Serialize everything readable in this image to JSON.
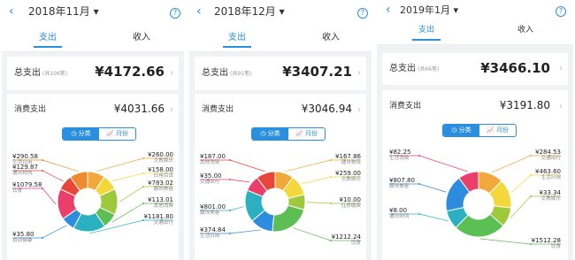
{
  "panels": [
    {
      "header": {
        "back": "‹",
        "title": "2018年11月 ▾",
        "help": "?"
      },
      "tabs": [
        "支出",
        "收入"
      ],
      "summary": {
        "total_label": "总支出",
        "total_count": "(共106笔)",
        "total_value": "¥4172.66",
        "consumption_label": "消费支出",
        "consumption_value": "¥4031.66",
        "arrow": "›"
      },
      "toggle": [
        "◷ 分类",
        "📈 月份"
      ],
      "chart_data": {
        "type": "pie",
        "slices": [
          {
            "value": "¥260.00",
            "label": "文教娱乐",
            "color": "#f0a93a"
          },
          {
            "value": "¥158.00",
            "label": "日用百货",
            "color": "#f3d83c"
          },
          {
            "value": "¥783.02",
            "label": "服饰美容",
            "color": "#9fc93c"
          },
          {
            "value": "¥113.01",
            "label": "其他消费",
            "color": "#5cbf54"
          },
          {
            "value": "¥1181.80",
            "label": "交通出行",
            "color": "#2bb0c2"
          },
          {
            "value": "¥35.80",
            "label": "运动健康",
            "color": "#2d8cde"
          },
          {
            "value": "¥1079.58",
            "label": "饮食",
            "color": "#ea3f6b"
          },
          {
            "value": "¥129.87",
            "label": "通讯物流",
            "color": "#e9463a"
          },
          {
            "value": "¥290.58",
            "label": "生活日用",
            "color": "#f08a2e"
          }
        ]
      }
    },
    {
      "header": {
        "back": "‹",
        "title": "2018年12月 ▾",
        "help": "?"
      },
      "tabs": [
        "支出",
        "收入"
      ],
      "summary": {
        "total_label": "总支出",
        "total_count": "(共91笔)",
        "total_value": "¥3407.21",
        "consumption_label": "消费支出",
        "consumption_value": "¥3046.94",
        "arrow": "›"
      },
      "toggle": [
        "◷ 分类",
        "📈 月份"
      ],
      "chart_data": {
        "type": "pie",
        "slices": [
          {
            "value": "¥167.86",
            "label": "通讯物流",
            "color": "#f0a93a"
          },
          {
            "value": "¥259.00",
            "label": "文教娱乐",
            "color": "#f3d83c"
          },
          {
            "value": "¥10.00",
            "label": "住房缴费",
            "color": "#9fc93c"
          },
          {
            "value": "¥1212.24",
            "label": "饮食",
            "color": "#5cbf54"
          },
          {
            "value": "¥374.84",
            "label": "生活日用",
            "color": "#2d8cde"
          },
          {
            "value": "¥801.00",
            "label": "服饰美容",
            "color": "#2bb0c2"
          },
          {
            "value": "¥35.00",
            "label": "交通出行",
            "color": "#ea3f6b"
          },
          {
            "value": "¥187.00",
            "label": "其他消费",
            "color": "#e9463a"
          }
        ]
      }
    },
    {
      "header": {
        "back": "‹",
        "title": "2019年1月 ▾",
        "help": "?"
      },
      "tabs": [
        "支出",
        "收入"
      ],
      "summary": {
        "total_label": "总支出",
        "total_count": "(共66笔)",
        "total_value": "¥3466.10",
        "consumption_label": "消费支出",
        "consumption_value": "¥3191.80",
        "arrow": "›"
      },
      "toggle": [
        "◷ 分类",
        "📈 月份"
      ],
      "chart_data": {
        "type": "pie",
        "slices": [
          {
            "value": "¥284.53",
            "label": "交通出行",
            "color": "#f0a93a"
          },
          {
            "value": "¥463.60",
            "label": "生活日用",
            "color": "#f3d83c"
          },
          {
            "value": "¥33.34",
            "label": "文教娱乐",
            "color": "#9fc93c"
          },
          {
            "value": "¥1512.28",
            "label": "饮食",
            "color": "#5cbf54"
          },
          {
            "value": "¥8.00",
            "label": "通讯物流",
            "color": "#2bb0c2"
          },
          {
            "value": "¥807.80",
            "label": "服饰美容",
            "color": "#2d8cde"
          },
          {
            "value": "¥82.25",
            "label": "生活消费",
            "color": "#ea3f6b"
          }
        ]
      }
    }
  ]
}
